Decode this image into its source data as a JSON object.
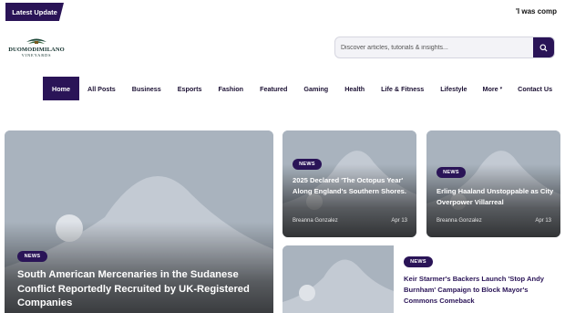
{
  "ticker": {
    "label": "Latest Update",
    "headline": "'I was comp"
  },
  "logo": {
    "name": "DUOMODIMILANO",
    "sub": "VINEYARDS"
  },
  "search": {
    "placeholder": "Discover articles, tutorials & insights...",
    "icon": "search-icon"
  },
  "nav": {
    "items": [
      "Home",
      "All Posts",
      "Business",
      "Esports",
      "Fashion",
      "Featured",
      "Gaming",
      "Health",
      "Life & Fitness",
      "Lifestyle",
      "More",
      "Contact Us"
    ],
    "more_caret": "▾"
  },
  "colors": {
    "accent": "#2a1457",
    "placeholder_bg": "#a9b3be",
    "placeholder_shape": "#c3cad3"
  },
  "articles": [
    {
      "category": "NEWS",
      "title": "South American Mercenaries in the Sudanese Conflict Reportedly Recruited by UK-Registered Companies"
    },
    {
      "category": "NEWS",
      "title": "2025 Declared 'The Octopus Year' Along England's Southern Shores.",
      "author": "Breanna Gonzalez",
      "date": "Apr 13"
    },
    {
      "category": "NEWS",
      "title": "Erling Haaland Unstoppable as City Overpower Villarreal",
      "author": "Breanna Gonzalez",
      "date": "Apr 13"
    },
    {
      "category": "NEWS",
      "title": "Keir Starmer's Backers Launch 'Stop Andy Burnham' Campaign to Block Mayor's Commons Comeback"
    }
  ]
}
